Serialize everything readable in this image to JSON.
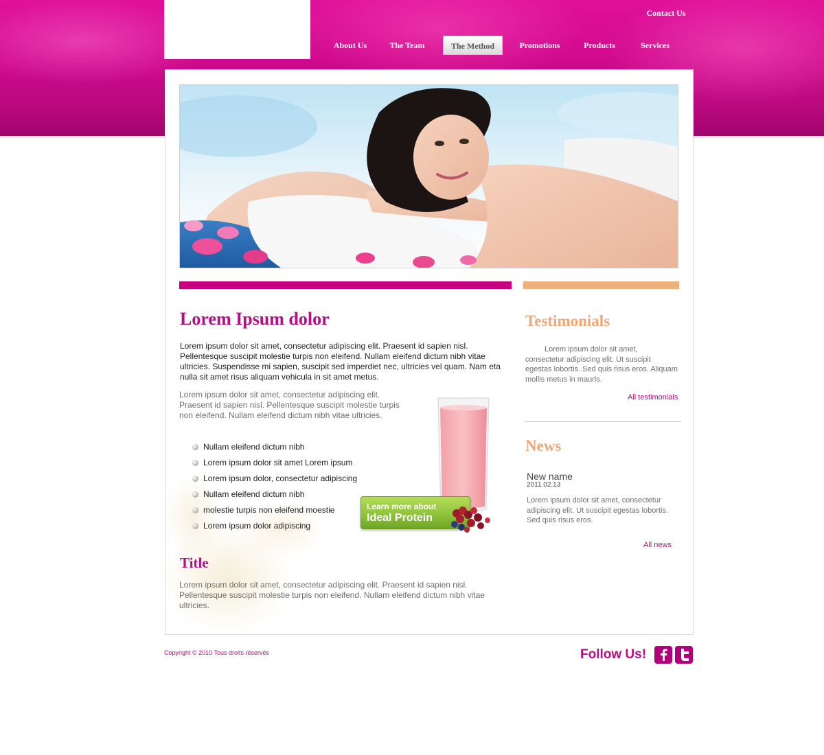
{
  "header": {
    "contact_label": "Contact Us",
    "nav": [
      {
        "label": "About Us",
        "active": false
      },
      {
        "label": "The Team",
        "active": false
      },
      {
        "label": "The Method",
        "active": true
      },
      {
        "label": "Promotions",
        "active": false
      },
      {
        "label": "Products",
        "active": false
      },
      {
        "label": "Services",
        "active": false
      }
    ]
  },
  "main": {
    "heading": "Lorem Ipsum dolor",
    "lead_paragraph": "Lorem ipsum dolor sit amet, consectetur adipiscing elit. Praesent id sapien nisl. Pellentesque suscipit molestie turpis non eleifend. Nullam eleifend dictum nibh vitae ultricies. Suspendisse mi sapien, suscipit sed imperdiet nec, ultricies vel quam. Nam eta nulla sit amet risus aliquam vehicula in sit amet metus.",
    "grey_paragraph": "Lorem ipsum dolor sit amet, consectetur adipiscing elit. Praesent id sapien nisl. Pellentesque suscipit molestie turpis non eleifend. Nullam eleifend dictum nibh vitae ultricies.",
    "bullets": [
      "Nullam eleifend dictum nibh",
      "Lorem ipsum dolor sit amet Lorem ipsum",
      "Lorem ipsum dolor, consectetur adipiscing",
      "Nullam eleifend dictum nibh",
      "molestie turpis non eleifend moestie",
      "Lorem ipsum dolor adipiscing"
    ],
    "cta": {
      "line1": "Learn more about",
      "line2": "Ideal Protein"
    },
    "title": "Title",
    "title_paragraph": "Lorem ipsum dolor sit amet, consectetur adipiscing elit. Praesent id sapien nisl. Pellentesque suscipit molestie turpis non eleifend. Nullam eleifend dictum nibh vitae ultricies."
  },
  "sidebar": {
    "testimonials": {
      "heading": "Testimonials",
      "text": "Lorem ipsum dolor sit amet, consectetur adipiscing elit.  Ut suscipit egestas lobortis. Sed quis risus eros. Aliquam mollis metus in mauris.",
      "link": "All testimonials"
    },
    "news": {
      "heading": "News",
      "item_name": "New name",
      "item_date": "2011.02.13",
      "text": "Lorem ipsum dolor sit amet, consectetur adipiscing elit. Ut suscipit egestas lobortis. Sed quis risus eros.",
      "link": "All news"
    }
  },
  "footer": {
    "copyright": "Copyright © 2010  Tous droits réservés",
    "follow": "Follow Us!",
    "social": [
      {
        "icon": "facebook-icon",
        "glyph": "f"
      },
      {
        "icon": "twitter-icon",
        "glyph": "t"
      }
    ]
  },
  "colors": {
    "brand_magenta": "#c4007f",
    "heading_magenta": "#b80d84",
    "sidebar_peach": "#efa875",
    "cta_green": "#8fc33a"
  }
}
